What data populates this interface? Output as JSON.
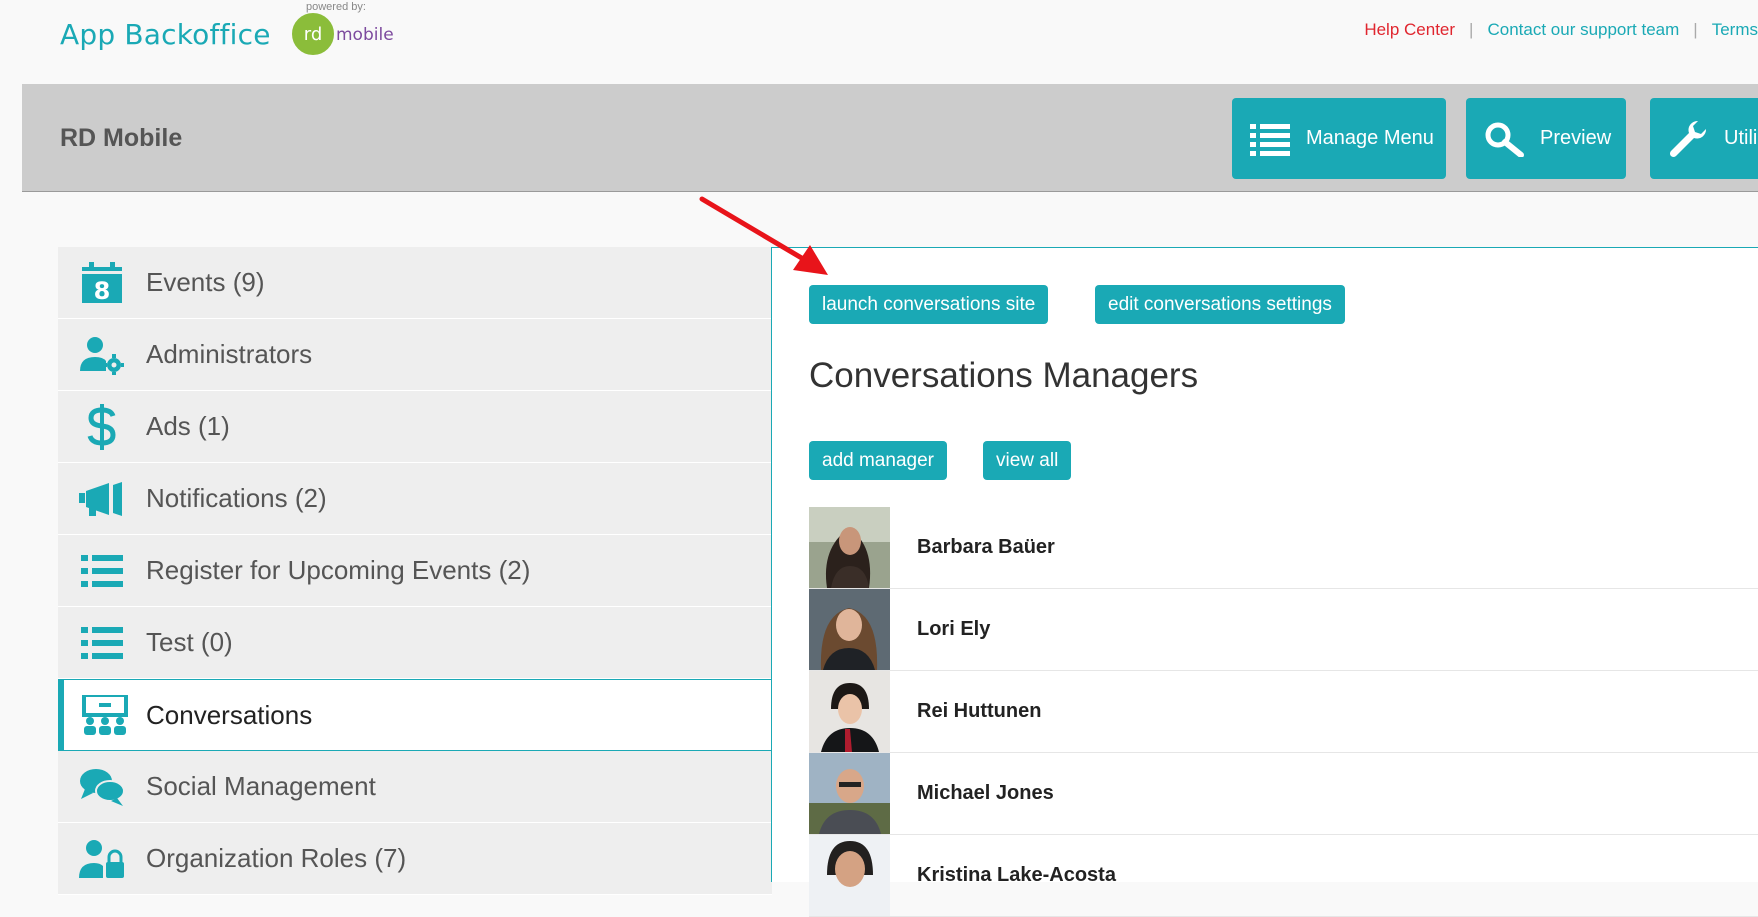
{
  "brand": {
    "app_name": "App Backoffice",
    "powered_by": "powered by:",
    "logo_rd": "rd",
    "logo_mobile": "mobile"
  },
  "top_links": {
    "help": "Help Center",
    "separator": "|",
    "contact": "Contact our support team",
    "terms": "Terms"
  },
  "header": {
    "org_name": "RD Mobile",
    "buttons": [
      {
        "label": "Manage Menu",
        "icon": "list-icon"
      },
      {
        "label": "Preview",
        "icon": "search-icon"
      },
      {
        "label": "Utili",
        "icon": "wrench-icon"
      }
    ]
  },
  "sidebar": {
    "items": [
      {
        "label": "Events (9)",
        "icon": "calendar-icon"
      },
      {
        "label": "Administrators",
        "icon": "user-gear-icon"
      },
      {
        "label": "Ads (1)",
        "icon": "dollar-icon"
      },
      {
        "label": "Notifications (2)",
        "icon": "megaphone-icon"
      },
      {
        "label": "Register for Upcoming Events (2)",
        "icon": "list-icon"
      },
      {
        "label": "Test (0)",
        "icon": "list-icon"
      },
      {
        "label": "Conversations",
        "icon": "conference-icon",
        "active": true
      },
      {
        "label": "Social Management",
        "icon": "chat-bubbles-icon"
      },
      {
        "label": "Organization Roles (7)",
        "icon": "user-lock-icon"
      }
    ]
  },
  "main": {
    "launch_label": "launch conversations site",
    "edit_label": "edit conversations settings",
    "title": "Conversations Managers",
    "add_label": "add manager",
    "view_all_label": "view all",
    "managers": [
      {
        "name": "Barbara Baüer"
      },
      {
        "name": "Lori Ely"
      },
      {
        "name": "Rei Huttunen"
      },
      {
        "name": "Michael Jones"
      },
      {
        "name": "Kristina Lake-Acosta"
      }
    ]
  },
  "colors": {
    "accent": "#1aa9b5",
    "help_link": "#e0262f",
    "arrow": "#e8141a",
    "header_band": "#cccccc",
    "sidebar_bg": "#eeeeee"
  },
  "icon_day_number": "8"
}
